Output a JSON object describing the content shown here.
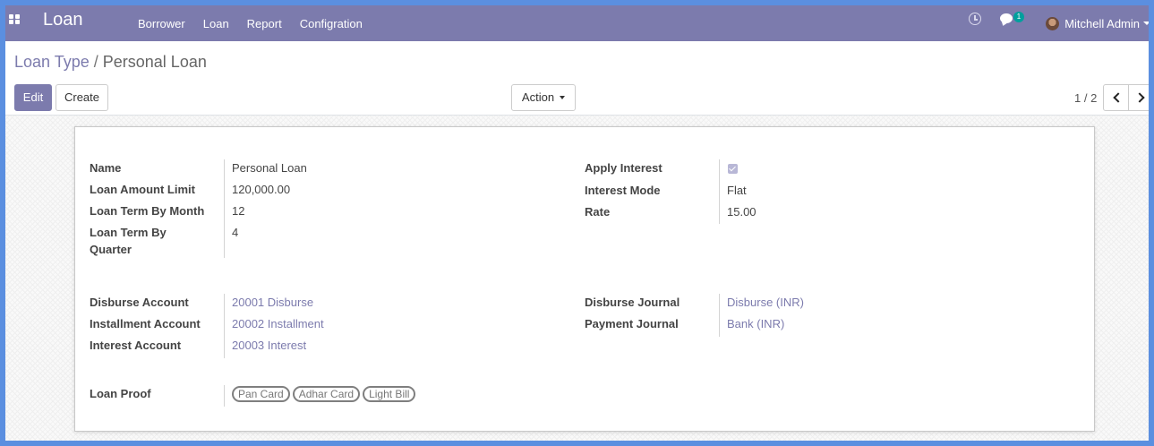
{
  "navbar": {
    "brand": "Loan",
    "menu": [
      "Borrower",
      "Loan",
      "Report",
      "Configration"
    ],
    "chat_count": "1",
    "user_name": "Mitchell Admin",
    "icons": [
      "apps-icon",
      "clock-icon",
      "chat-icon",
      "avatar",
      "caret-icon"
    ]
  },
  "breadcrumb": {
    "parent": "Loan Type",
    "separator": "/",
    "current": "Personal Loan"
  },
  "toolbar": {
    "edit_label": "Edit",
    "create_label": "Create",
    "action_label": "Action"
  },
  "pager": {
    "value": "1 / 2"
  },
  "form": {
    "left_group": {
      "name_label": "Name",
      "name_value": "Personal Loan",
      "amount_label": "Loan Amount Limit",
      "amount_value": "120,000.00",
      "term_month_label": "Loan Term By Month",
      "term_month_value": "12",
      "term_quarter_label_1": "Loan Term By",
      "term_quarter_label_2": "Quarter",
      "term_quarter_value": "4"
    },
    "right_group": {
      "apply_interest_label": "Apply Interest",
      "apply_interest_checked": true,
      "interest_mode_label": "Interest Mode",
      "interest_mode_value": "Flat",
      "rate_label": "Rate",
      "rate_value": "15.00"
    },
    "accounts": {
      "disburse_label": "Disburse Account",
      "disburse_value": "20001 Disburse",
      "installment_label": "Installment Account",
      "installment_value": "20002 Installment",
      "interest_label": "Interest Account",
      "interest_value": "20003 Interest"
    },
    "journals": {
      "disburse_label": "Disburse Journal",
      "disburse_value": "Disburse (INR)",
      "payment_label": "Payment Journal",
      "payment_value": "Bank (INR)"
    },
    "proof": {
      "label": "Loan Proof",
      "tags": [
        "Pan Card",
        "Adhar Card",
        "Light Bill"
      ]
    }
  },
  "colors": {
    "navbar": "#7c7bad",
    "link": "#7c7bad",
    "badge": "#00a09d"
  }
}
